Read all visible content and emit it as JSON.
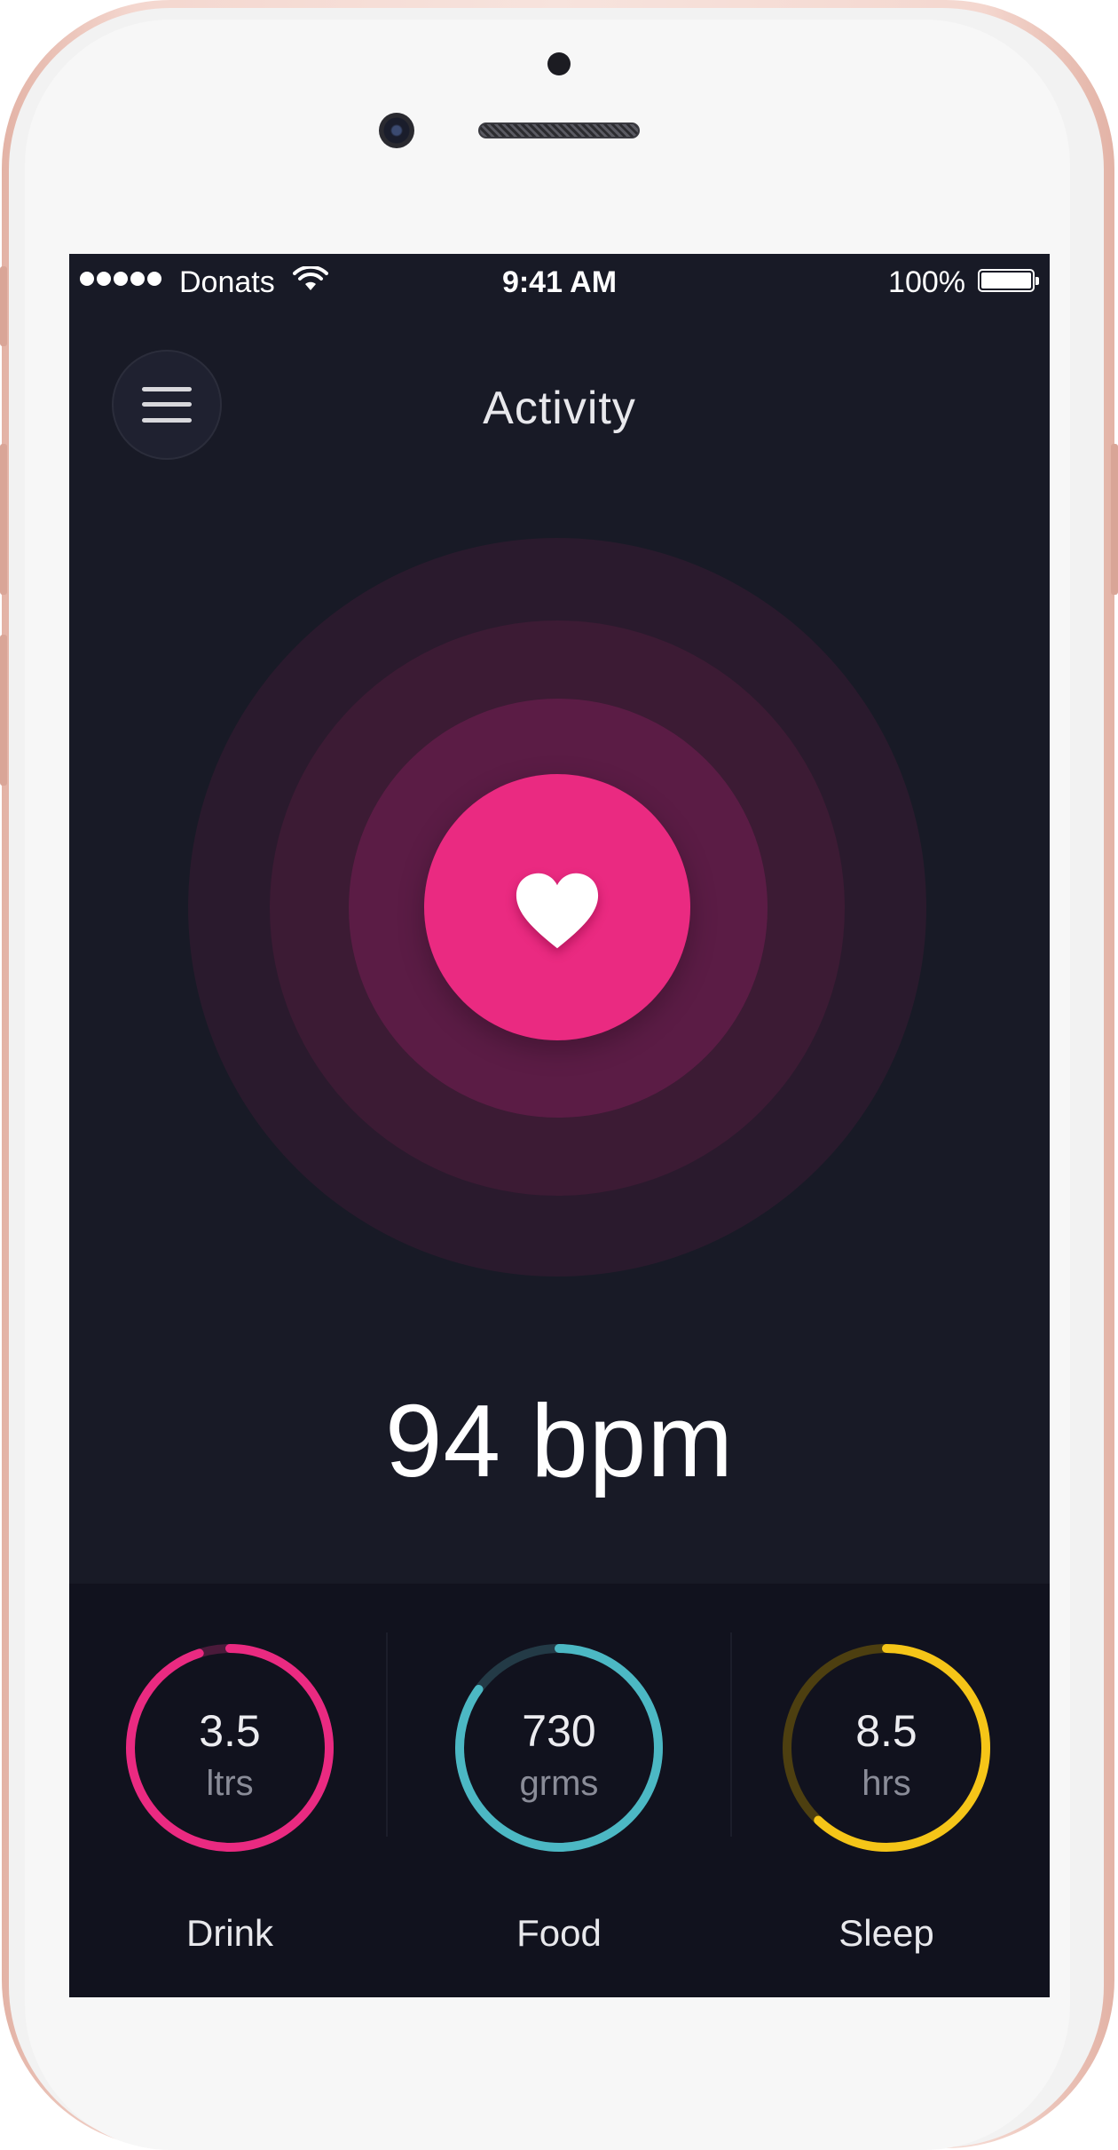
{
  "status_bar": {
    "carrier": "Donats",
    "time": "9:41 AM",
    "battery": "100%"
  },
  "header": {
    "title": "Activity",
    "menu_icon": "hamburger-icon"
  },
  "heart_rate": {
    "value": "94",
    "unit": "bpm",
    "icon": "heart-icon",
    "accent": "#ea2a81"
  },
  "stats": [
    {
      "label": "Drink",
      "value": "3.5",
      "unit": "ltrs",
      "progress": 0.95,
      "color": "#ea2a81",
      "track": "#4a1a3a"
    },
    {
      "label": "Food",
      "value": "730",
      "unit": "grms",
      "progress": 0.85,
      "color": "#4cb8c4",
      "track": "#233a46"
    },
    {
      "label": "Sleep",
      "value": "8.5",
      "unit": "hrs",
      "progress": 0.62,
      "color": "#f5c518",
      "track": "#4d3f10"
    }
  ]
}
